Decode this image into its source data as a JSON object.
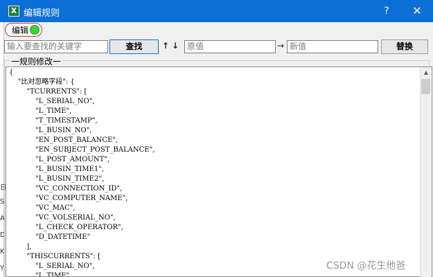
{
  "window": {
    "title": "编辑规则",
    "app_icon": "excel-icon",
    "help_label": "?",
    "close_label": "✕",
    "accent": "#0a6fd6"
  },
  "background_strip": {
    "chars": [
      "日",
      "S",
      "A",
      "D",
      "K",
      "Y"
    ]
  },
  "toolbar": {
    "edit_label": "编辑",
    "edit_state_color": "#3ad43a",
    "search_placeholder": "输入要查找的关键字",
    "find_label": "查找",
    "up_glyph": "↑",
    "down_glyph": "↓",
    "old_value_placeholder": "原值",
    "arrow_glyph": "→",
    "new_value_placeholder": "新值",
    "replace_label": "替换"
  },
  "group": {
    "label": "一规则修改一"
  },
  "editor": {
    "lines": [
      "{",
      "    \"比对忽略字段\": {",
      "        \"TCURRENTS\": [",
      "            \"L_SERIAL_NO\",",
      "            \"L_TIME\",",
      "            \"T_TIMESTAMP\",",
      "            \"L_BUSIN_NO\",",
      "            \"EN_POST_BALANCE\",",
      "            \"EN_SUBJECT_POST_BALANCE\",",
      "            \"L_POST_AMOUNT\",",
      "            \"L_BUSIN_TIME1\",",
      "            \"L_BUSIN_TIME2\",",
      "            \"VC_CONNECTION_ID\",",
      "            \"VC_COMPUTER_NAME\",",
      "            \"VC_MAC\",",
      "            \"VC_VOLSERIAL_NO\",",
      "            \"L_CHECK_OPERATOR\",",
      "            \"D_DATETIME\"",
      "        ],",
      "        \"THISCURRENTS\": [",
      "            \"L_SERIAL_NO\",",
      "            \"L_TIME\","
    ]
  },
  "watermark": "CSDN @花生他爸"
}
